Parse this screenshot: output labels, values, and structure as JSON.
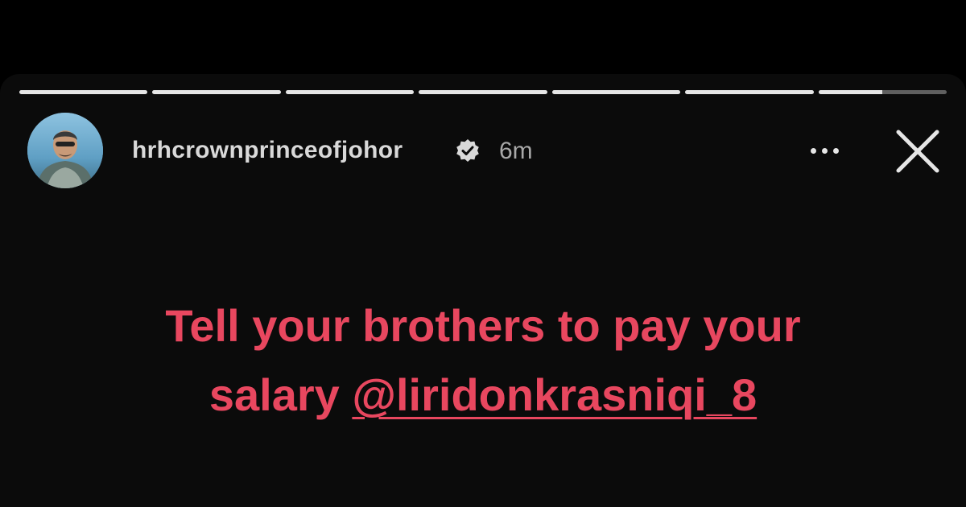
{
  "story": {
    "segments": [
      1,
      1,
      1,
      1,
      1,
      1,
      0.5
    ],
    "accent_text_color": "#e8475f",
    "header": {
      "username": "hrhcrownprinceofjohor",
      "timestamp": "6m",
      "verified_icon": "verified-badge-icon",
      "more_icon": "more-options-icon",
      "close_icon": "close-icon"
    },
    "caption": {
      "line1": "Tell your brothers to pay your",
      "line2_prefix": "salary ",
      "mention": "@liridonkrasniqi_8"
    }
  }
}
